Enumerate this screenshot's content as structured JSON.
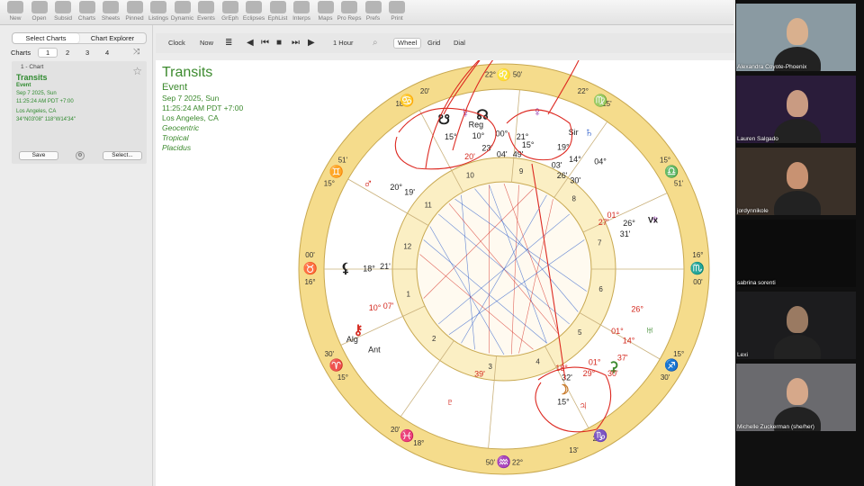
{
  "toolbar": {
    "items": [
      "New",
      "Open",
      "Subsid",
      "Charts",
      "Sheets",
      "Pinned",
      "Listings",
      "Dynamic",
      "Events",
      "GrEph",
      "Eclipses",
      "EphList",
      "Interps",
      "Maps",
      "Pro Reps",
      "Prefs",
      "Print"
    ]
  },
  "sidebar": {
    "tabs": [
      "Select Charts",
      "Chart Explorer"
    ],
    "charts_label": "Charts",
    "chart_numbers": [
      "1",
      "2",
      "3",
      "4"
    ],
    "card": {
      "caption": "1 - Chart",
      "title": "Transits",
      "type": "Event",
      "date": "Sep 7 2025, Sun",
      "time": "11:25:24 AM PDT +7:00",
      "place": "Los Angeles, CA",
      "coords": "34°N03'08\" 118°W14'34\"",
      "save_label": "Save",
      "select_label": "Select..."
    }
  },
  "controls": {
    "clock": "Clock",
    "now": "Now",
    "interval": "1 Hour",
    "views": [
      "Wheel",
      "Grid",
      "Dial"
    ],
    "active_view": "Wheel"
  },
  "chart_info": {
    "title": "Transits",
    "type": "Event",
    "date": "Sep 7 2025, Sun",
    "time": "11:25:24 AM PDT +7:00",
    "place": "Los Angeles, CA",
    "geo": "Geocentric",
    "zodiac": "Tropical",
    "houses": "Placidus"
  },
  "wheel": {
    "colors": {
      "outer_ring": "#f5dc8c",
      "inner_ring": "#fbefc4",
      "red": "#d4281e",
      "blue": "#2356c8",
      "green": "#3c8a2e",
      "purple": "#8a2aa8",
      "annotation": "#dd2a22"
    },
    "cusp_degrees": [
      {
        "deg": "22°",
        "min": "50'"
      },
      {
        "deg": "18°",
        "min": "20'"
      },
      {
        "deg": "15°",
        "min": "51'"
      },
      {
        "deg": "16°",
        "min": "00'"
      },
      {
        "deg": "15°",
        "min": "30'"
      },
      {
        "deg": "18°",
        "min": "20'"
      },
      {
        "deg": "22°",
        "min": "50'"
      },
      {
        "deg": "25°",
        "min": "13'"
      },
      {
        "deg": "15°",
        "min": "30'"
      },
      {
        "deg": "16°",
        "min": "00'"
      },
      {
        "deg": "15°",
        "min": "51'"
      },
      {
        "deg": "22°",
        "min": "25'"
      }
    ],
    "house_numbers": [
      "1",
      "2",
      "3",
      "4",
      "5",
      "6",
      "7",
      "8",
      "9",
      "10",
      "11",
      "12"
    ],
    "planet_labels": [
      {
        "text": "Reg",
        "color": "#222"
      },
      {
        "text": "Sir",
        "color": "#222"
      },
      {
        "text": "Vx",
        "color": "#222"
      },
      {
        "text": "Alg",
        "color": "#222"
      },
      {
        "text": "Ant",
        "color": "#222"
      },
      {
        "text": "15°",
        "color": "#222"
      },
      {
        "text": "10°",
        "color": "#222"
      },
      {
        "text": "00°",
        "color": "#222"
      },
      {
        "text": "21°",
        "color": "#222"
      },
      {
        "text": "15°",
        "color": "#222"
      },
      {
        "text": "19°",
        "color": "#222"
      },
      {
        "text": "14°",
        "color": "#222"
      },
      {
        "text": "04°",
        "color": "#222"
      },
      {
        "text": "20°",
        "color": "#222"
      },
      {
        "text": "19'",
        "color": "#222"
      },
      {
        "text": "26°",
        "color": "#222"
      },
      {
        "text": "31'",
        "color": "#222"
      },
      {
        "text": "18°",
        "color": "#222"
      },
      {
        "text": "21'",
        "color": "#222"
      },
      {
        "text": "10°",
        "color": "#d4281e"
      },
      {
        "text": "07'",
        "color": "#d4281e"
      },
      {
        "text": "26°",
        "color": "#d4281e"
      },
      {
        "text": "01°",
        "color": "#d4281e"
      },
      {
        "text": "27'",
        "color": "#d4281e"
      },
      {
        "text": "01°",
        "color": "#d4281e"
      },
      {
        "text": "39'",
        "color": "#d4281e"
      },
      {
        "text": "15°",
        "color": "#222"
      },
      {
        "text": "29°",
        "color": "#d4281e"
      },
      {
        "text": "01°",
        "color": "#d4281e"
      },
      {
        "text": "14°",
        "color": "#d4281e"
      },
      {
        "text": "37'",
        "color": "#d4281e"
      },
      {
        "text": "30'",
        "color": "#d4281e"
      },
      {
        "text": "49'",
        "color": "#222"
      },
      {
        "text": "23'",
        "color": "#222"
      },
      {
        "text": "04'",
        "color": "#222"
      },
      {
        "text": "20'",
        "color": "#d4281e"
      },
      {
        "text": "18°",
        "color": "#d4281e"
      },
      {
        "text": "03'",
        "color": "#222"
      },
      {
        "text": "26'",
        "color": "#222"
      },
      {
        "text": "30'",
        "color": "#222"
      },
      {
        "text": "32'",
        "color": "#222"
      }
    ]
  },
  "participants": [
    {
      "name": "Alexandra Coyote-Phoenix"
    },
    {
      "name": "Lauren Salgado"
    },
    {
      "name": "jordynnikole"
    },
    {
      "name": "sabrina sorenti"
    },
    {
      "name": "Lexi"
    },
    {
      "name": "Michelle Zuckerman (she/her)"
    }
  ]
}
